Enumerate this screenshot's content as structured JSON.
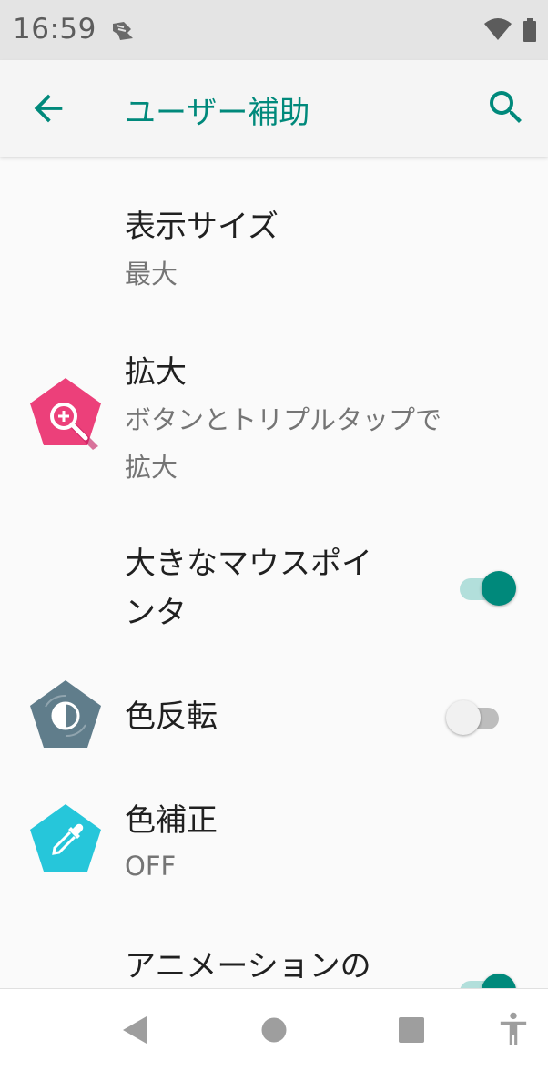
{
  "status_bar": {
    "time": "16:59",
    "icons": [
      "notification-icon",
      "wifi-icon",
      "battery-icon"
    ]
  },
  "app_bar": {
    "title": "ユーザー補助",
    "back_icon": "arrow-back-icon",
    "search_icon": "search-icon"
  },
  "colors": {
    "accent": "#00897b",
    "magnification": "#ec407a",
    "color_inversion": "#607d8b",
    "color_correction": "#26c6da"
  },
  "settings": [
    {
      "title": "表示サイズ",
      "summary": "最大"
    },
    {
      "title": "拡大",
      "summary_line1": "ボタンとトリプルタップで",
      "summary_line2": "拡大",
      "icon": "magnify-icon"
    },
    {
      "title_line1": "大きなマウスポイ",
      "title_line2": "ンタ",
      "toggle_on": true
    },
    {
      "title": "色反転",
      "icon": "invert-colors-icon",
      "toggle_on": false
    },
    {
      "title": "色補正",
      "summary": "OFF",
      "icon": "eyedropper-icon"
    },
    {
      "title": "アニメーションの",
      "toggle_on": true
    }
  ],
  "nav_bar": {
    "icons": [
      "back-triangle-icon",
      "home-circle-icon",
      "recents-square-icon",
      "accessibility-icon"
    ]
  }
}
